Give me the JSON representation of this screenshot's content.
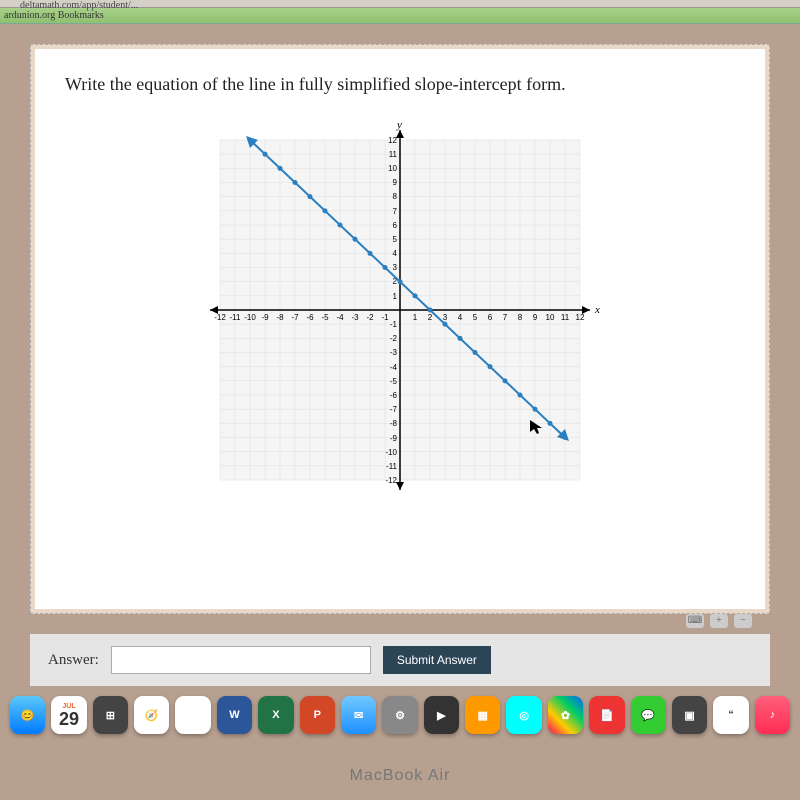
{
  "browser": {
    "url_fragment": "deltamath.com/app/student/...",
    "bookmark": "ardunion.org Bookmarks"
  },
  "prompt_text": "Write the equation of the line in fully simplified slope-intercept form.",
  "chart_data": {
    "type": "line",
    "title": "",
    "xlabel": "x",
    "ylabel": "y",
    "xlim": [
      -12,
      12
    ],
    "ylim": [
      -12,
      12
    ],
    "x_ticks": [
      -12,
      -11,
      -10,
      -9,
      -8,
      -7,
      -6,
      -5,
      -4,
      -3,
      -2,
      -1,
      1,
      2,
      3,
      4,
      5,
      6,
      7,
      8,
      9,
      10,
      11,
      12
    ],
    "y_ticks": [
      -12,
      -11,
      -10,
      -9,
      -8,
      -7,
      -6,
      -5,
      -4,
      -3,
      -2,
      -1,
      1,
      2,
      3,
      4,
      5,
      6,
      7,
      8,
      9,
      10,
      11,
      12
    ],
    "line_points": [
      {
        "x": -10,
        "y": 12
      },
      {
        "x": -9,
        "y": 11
      },
      {
        "x": -8,
        "y": 10
      },
      {
        "x": -7,
        "y": 9
      },
      {
        "x": -6,
        "y": 8
      },
      {
        "x": -5,
        "y": 7
      },
      {
        "x": -4,
        "y": 6
      },
      {
        "x": -3,
        "y": 5
      },
      {
        "x": -2,
        "y": 4
      },
      {
        "x": -1,
        "y": 3
      },
      {
        "x": 0,
        "y": 2
      },
      {
        "x": 1,
        "y": 1
      },
      {
        "x": 2,
        "y": 0
      },
      {
        "x": 3,
        "y": -1
      },
      {
        "x": 4,
        "y": -2
      },
      {
        "x": 5,
        "y": -3
      },
      {
        "x": 6,
        "y": -4
      },
      {
        "x": 7,
        "y": -5
      },
      {
        "x": 8,
        "y": -6
      },
      {
        "x": 9,
        "y": -7
      },
      {
        "x": 10,
        "y": -8
      },
      {
        "x": 11,
        "y": -9
      }
    ],
    "slope": -1,
    "y_intercept": 2
  },
  "answer": {
    "label": "Answer:",
    "value": "",
    "placeholder": "",
    "submit_label": "Submit Answer"
  },
  "tools": {
    "keyboard_icon": "⌨",
    "plus_icon": "+",
    "minus_icon": "−"
  },
  "dock": {
    "calendar": {
      "month": "JUL",
      "day": "29"
    },
    "word": "W",
    "excel": "X",
    "powerpoint": "P"
  },
  "device": "MacBook Air"
}
